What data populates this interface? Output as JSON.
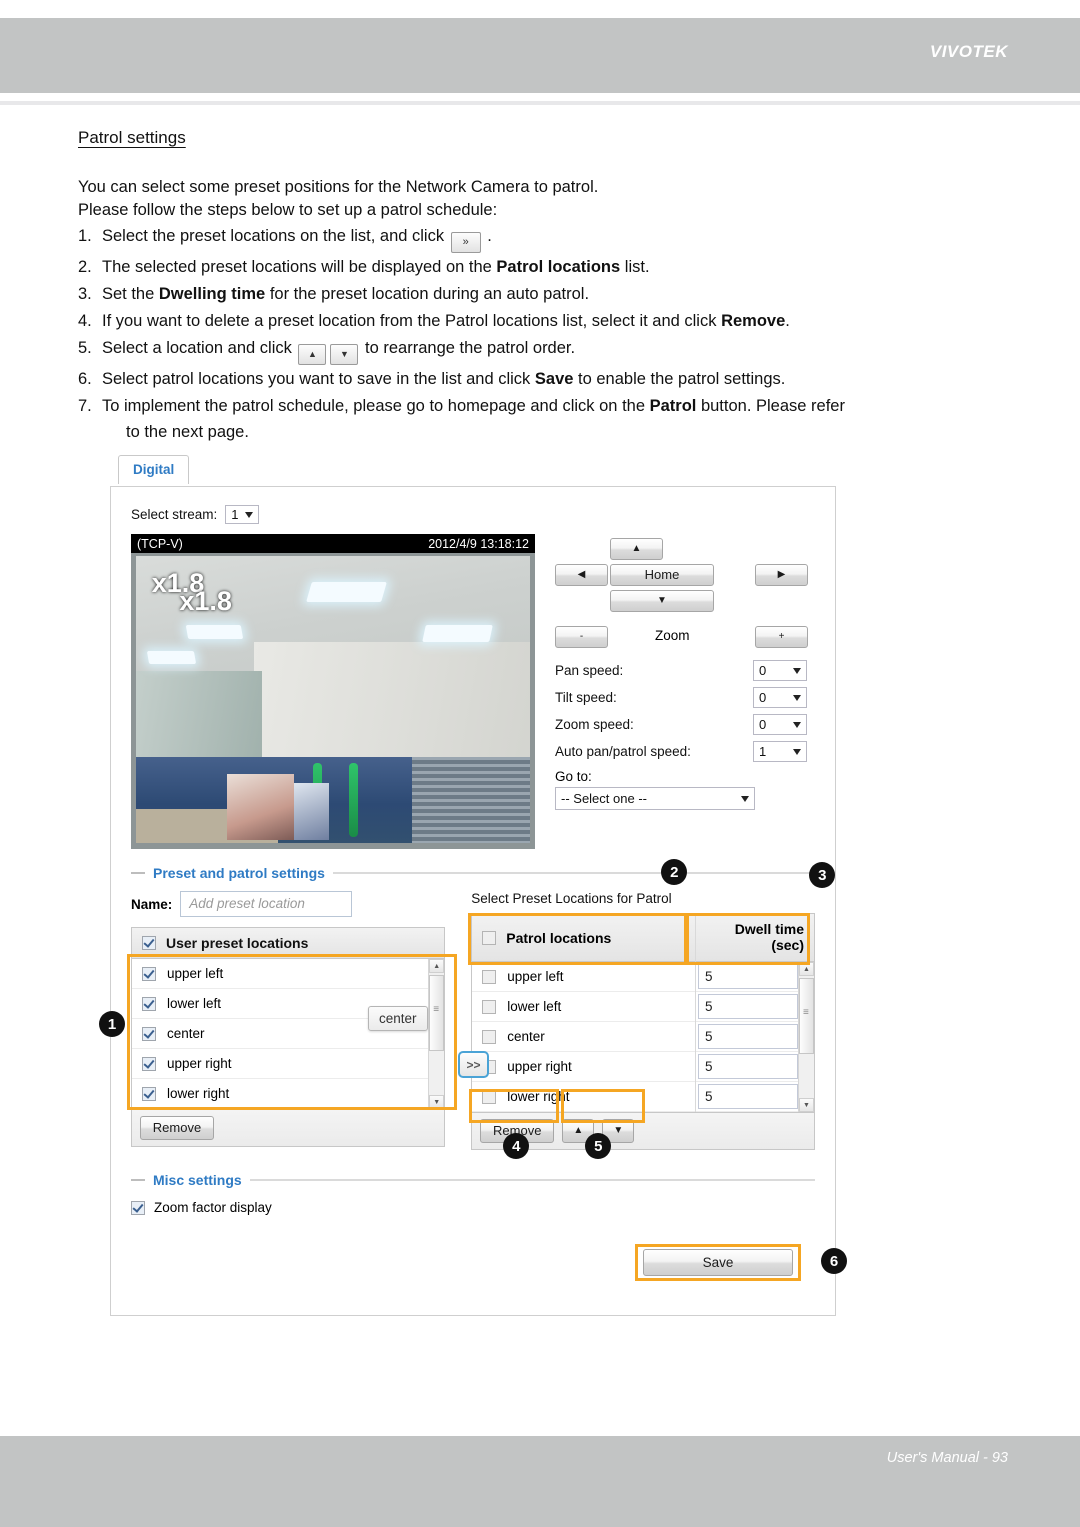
{
  "header": {
    "brand": "VIVOTEK"
  },
  "doc": {
    "section_title": "Patrol settings",
    "intro_line1": "You can select some preset positions for the Network Camera to patrol.",
    "intro_line2": "Please follow the steps below to set up a patrol schedule:",
    "steps": [
      {
        "num": "1.",
        "pre": "Select the preset locations on the list, and click ",
        "icon": "»",
        "post": " ."
      },
      {
        "num": "2.",
        "pre": "The selected preset locations will be displayed on the ",
        "bold": "Patrol locations",
        "post": " list."
      },
      {
        "num": "3.",
        "pre": "Set the ",
        "bold": "Dwelling time",
        "post": " for the preset location during an auto patrol."
      },
      {
        "num": "4.",
        "pre": "If you want to delete a preset location from the Patrol locations list, select it and click ",
        "bold": "Remove",
        "post": "."
      },
      {
        "num": "5.",
        "pre": "Select a location and click ",
        "icon": "▲",
        "icon2": "▼",
        "post": " to rearrange the patrol order."
      },
      {
        "num": "6.",
        "pre": "Select patrol locations you want to save in the list and click ",
        "bold": "Save",
        "post": " to enable the patrol settings."
      },
      {
        "num": "7.",
        "pre": "To implement the patrol schedule, please go to homepage and click on the ",
        "bold": "Patrol",
        "post": " button. Please refer",
        "cont": "to the next page."
      }
    ]
  },
  "ui": {
    "tab_label": "Digital",
    "stream": {
      "label": "Select stream:",
      "value": "1"
    },
    "video": {
      "protocol": "(TCP-V)",
      "timestamp": "2012/4/9 13:18:12",
      "zoom_factor_1": "x1.8",
      "zoom_factor_2": "x1.8"
    },
    "ptz": {
      "up": "▲",
      "down": "▼",
      "left": "◀",
      "right": "▶",
      "home": "Home",
      "zoom_label": "Zoom",
      "zoom_out": "-",
      "zoom_in": "+",
      "pan_speed_label": "Pan speed:",
      "pan_speed": "0",
      "tilt_speed_label": "Tilt speed:",
      "tilt_speed": "0",
      "zoom_speed_label": "Zoom speed:",
      "zoom_speed": "0",
      "auto_speed_label": "Auto pan/patrol speed:",
      "auto_speed": "1",
      "goto_label": "Go to:",
      "goto_value": "-- Select one --"
    },
    "preset_section": {
      "title": "Preset and patrol settings",
      "name_label": "Name:",
      "name_placeholder": "Add preset location",
      "user_list_header": "User preset locations",
      "user_items": [
        "upper left",
        "lower left",
        "center",
        "upper right",
        "lower right"
      ],
      "remove_label": "Remove",
      "tooltip": "center",
      "transfer_label": ">>",
      "right_caption": "Select Preset Locations for Patrol",
      "patrol_header": "Patrol locations",
      "dwell_header_line1": "Dwell time",
      "dwell_header_line2": "(sec)",
      "patrol_items": [
        "upper left",
        "lower left",
        "center",
        "upper right",
        "lower right"
      ],
      "dwell_values": [
        "5",
        "5",
        "5",
        "5",
        "5"
      ],
      "move_up": "▲",
      "move_down": "▼"
    },
    "misc_section": {
      "title": "Misc settings",
      "zoom_factor_label": "Zoom factor display"
    },
    "save_label": "Save",
    "badges": [
      "1",
      "2",
      "3",
      "4",
      "5",
      "6"
    ],
    "accent_highlight": "#f5a623",
    "accent_link": "#2f7bc4"
  },
  "footer": {
    "text": "User's Manual - 93"
  }
}
